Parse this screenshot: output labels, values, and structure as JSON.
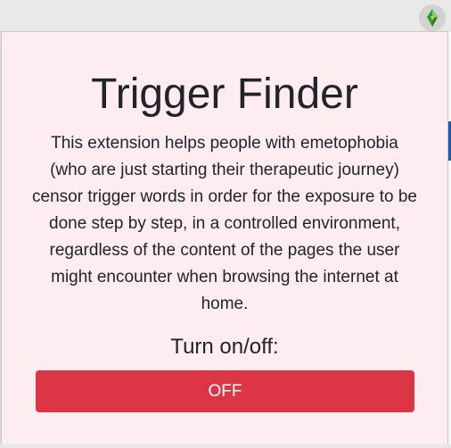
{
  "popup": {
    "title": "Trigger Finder",
    "description": "This extension helps people with emetophobia (who are just starting their therapeutic journey) censor trigger words in order for the exposure to be done step by step, in a controlled environment, regardless of the content of the pages the user might encounter when browsing the internet at home.",
    "toggle_label": "Turn on/off:",
    "toggle_button_label": "OFF"
  },
  "colors": {
    "popup_background": "#fdedf0",
    "button_off": "#dc3545",
    "text": "#212529"
  },
  "icons": {
    "extension": "extension-icon"
  }
}
